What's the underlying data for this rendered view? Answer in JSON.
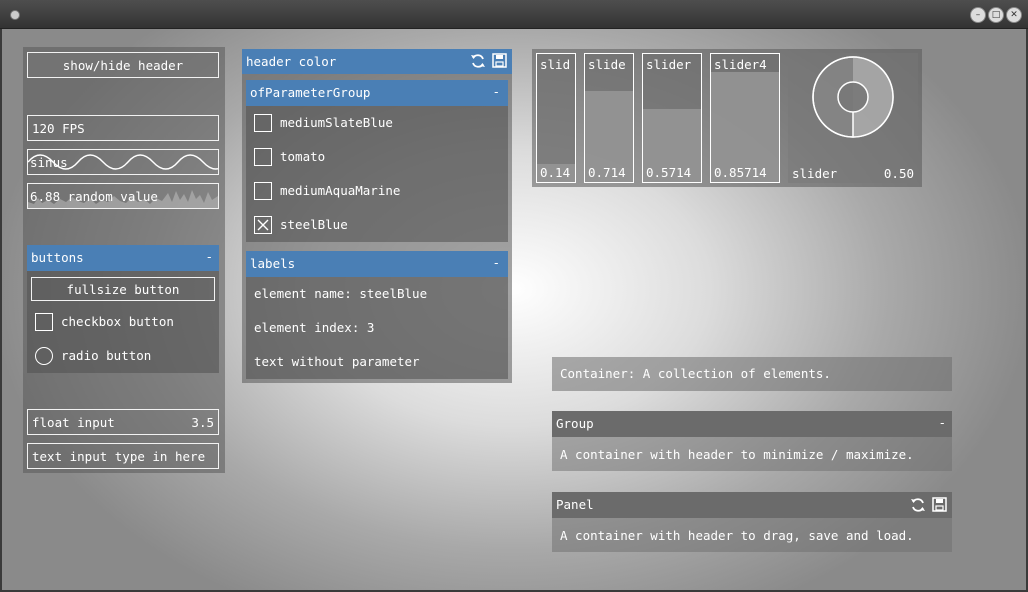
{
  "window": {
    "title": ""
  },
  "left": {
    "toggle_label": "show/hide header",
    "fps_label": "120 FPS",
    "sinus_label": "sinus",
    "random_label": "6.88 random value",
    "buttons_group": {
      "title": "buttons",
      "collapse": "-",
      "fullsize_label": "fullsize button",
      "checkbox_label": "checkbox button",
      "radio_label": "radio button"
    },
    "float_input": {
      "label": "float input",
      "value": "3.5"
    },
    "text_input": {
      "value": "text input type in here"
    }
  },
  "middle": {
    "header_title": "header color",
    "param_group": {
      "title": "ofParameterGroup",
      "collapse": "-",
      "items": [
        {
          "label": "mediumSlateBlue",
          "checked": false
        },
        {
          "label": "tomato",
          "checked": false
        },
        {
          "label": "mediumAquaMarine",
          "checked": false
        },
        {
          "label": "steelBlue",
          "checked": true
        }
      ]
    },
    "labels_group": {
      "title": "labels",
      "collapse": "-",
      "lines": [
        "element name: steelBlue",
        "element index: 3",
        "text without parameter"
      ]
    }
  },
  "sliders": {
    "items": [
      {
        "label": "slid",
        "value_text": "0.14",
        "level": 0.14
      },
      {
        "label": "slide",
        "value_text": "0.714",
        "level": 0.714
      },
      {
        "label": "slider",
        "value_text": "0.5714",
        "level": 0.5714
      },
      {
        "label": "slider4",
        "value_text": "0.85714",
        "level": 0.85714
      }
    ],
    "rotary": {
      "label": "slider",
      "value_text": "0.50",
      "level": 0.5
    }
  },
  "right": {
    "container_text": "Container: A collection of elements.",
    "group": {
      "title": "Group",
      "collapse": "-",
      "text": "A container with header to minimize / maximize."
    },
    "panel": {
      "title": "Panel",
      "text": "A container with header to drag, save and load."
    }
  },
  "colors": {
    "accent": "#4a7fb5",
    "panel_bg": "#5a5a5a",
    "border": "#f2f2f2"
  }
}
